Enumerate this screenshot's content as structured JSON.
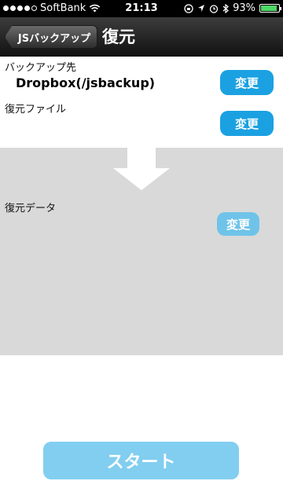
{
  "status_bar": {
    "carrier": "SoftBank",
    "time": "21:13",
    "battery_percent": "93%",
    "battery_level": 0.93,
    "signal_bars_filled": 4,
    "signal_bars_total": 5
  },
  "navbar": {
    "back_label": "JSバックアップ",
    "title": "復元"
  },
  "backup_destination": {
    "label": "バックアップ先",
    "value": "Dropbox(/jsbackup)",
    "change_label": "変更"
  },
  "restore_file": {
    "label": "復元ファイル",
    "change_label": "変更"
  },
  "restore_data": {
    "label": "復元データ",
    "change_label": "変更"
  },
  "start_button": {
    "label": "スタート"
  },
  "colors": {
    "accent": "#1ba1e2",
    "accent_disabled": "#82cef0",
    "panel": "#d9d9d9"
  }
}
